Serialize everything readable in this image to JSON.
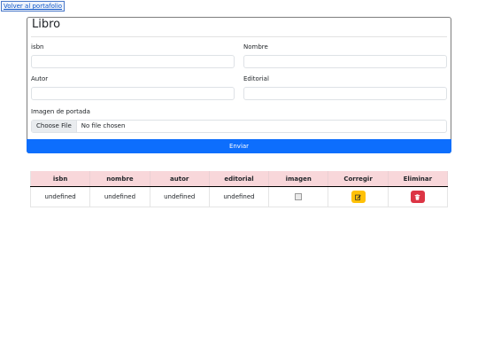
{
  "nav": {
    "back_label": "Volver al portafolio"
  },
  "form": {
    "title": "Libro",
    "isbn_label": "isbn",
    "nombre_label": "Nombre",
    "autor_label": "Autor",
    "editorial_label": "Editorial",
    "imagen_label": "Imagen de portada",
    "file_button_label": "Choose File",
    "file_status": "No file chosen",
    "submit_label": "Enviar"
  },
  "table": {
    "headers": [
      "isbn",
      "nombre",
      "autor",
      "editorial",
      "imagen",
      "Corregir",
      "Eliminar"
    ],
    "rows": [
      {
        "isbn": "undefined",
        "nombre": "undefined",
        "autor": "undefined",
        "editorial": "undefined"
      }
    ]
  },
  "icons": {
    "edit": "pencil-square-icon",
    "delete": "trash-icon",
    "broken_image": "broken-image-icon"
  },
  "colors": {
    "primary": "#0d6efd",
    "header_bg": "#f8d7da",
    "warning": "#ffc107",
    "danger": "#dc3545"
  }
}
